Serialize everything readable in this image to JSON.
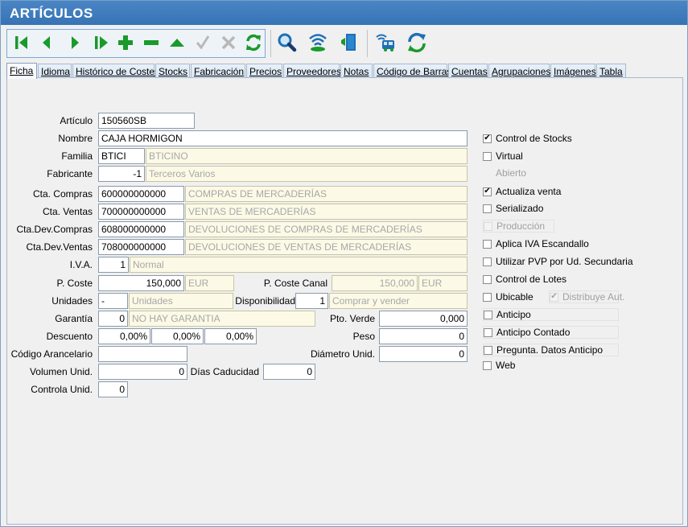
{
  "window": {
    "title": "ARTÍCULOS"
  },
  "toolbar": {
    "buttons": [
      {
        "name": "first-record",
        "icon": "first-icon"
      },
      {
        "name": "previous-record",
        "icon": "previous-icon"
      },
      {
        "name": "next-record",
        "icon": "next-icon"
      },
      {
        "name": "last-record",
        "icon": "last-icon"
      },
      {
        "name": "add-record",
        "icon": "plus-icon"
      },
      {
        "name": "delete-record",
        "icon": "minus-icon"
      },
      {
        "name": "edit-record",
        "icon": "triangle-up-icon"
      },
      {
        "name": "confirm-edit",
        "icon": "check-icon"
      },
      {
        "name": "cancel-edit",
        "icon": "x-icon"
      },
      {
        "name": "refresh",
        "icon": "refresh-icon"
      },
      {
        "name": "search",
        "icon": "magnifier-icon"
      },
      {
        "name": "broadcast",
        "icon": "signal-icon"
      },
      {
        "name": "exit",
        "icon": "door-icon"
      },
      {
        "name": "transport",
        "icon": "bus-icon"
      },
      {
        "name": "sync",
        "icon": "sync-icon"
      }
    ],
    "colors": {
      "accent": "#1a9a2a",
      "disabled": "#b0b0b0",
      "blue": "#1f6fb5"
    }
  },
  "tabs": [
    "Ficha",
    "Idioma",
    "Histórico de Costes",
    "Stocks",
    "Fabricación",
    "Precios",
    "Proveedores",
    "Notas",
    "Código de Barras",
    "Cuentas",
    "Agrupaciones",
    "Imágenes",
    "Tabla"
  ],
  "form": {
    "articulo": {
      "label": "Artículo",
      "value": "150560SB"
    },
    "nombre": {
      "label": "Nombre",
      "value": "CAJA HORMIGON"
    },
    "familia": {
      "label": "Familia",
      "code": "BTICI",
      "desc": "BTICINO"
    },
    "fabricante": {
      "label": "Fabricante",
      "code": "-1",
      "desc": "Terceros Varios"
    },
    "cta_compras": {
      "label": "Cta. Compras",
      "code": "600000000000",
      "desc": "COMPRAS DE MERCADERÍAS"
    },
    "cta_ventas": {
      "label": "Cta. Ventas",
      "code": "700000000000",
      "desc": "VENTAS DE MERCADERÍAS"
    },
    "cta_dev_compras": {
      "label": "Cta.Dev.Compras",
      "code": "608000000000",
      "desc": "DEVOLUCIONES DE COMPRAS DE MERCADERÍAS"
    },
    "cta_dev_ventas": {
      "label": "Cta.Dev.Ventas",
      "code": "708000000000",
      "desc": "DEVOLUCIONES DE VENTAS DE MERCADERÍAS"
    },
    "iva": {
      "label": "I.V.A.",
      "code": "1",
      "desc": "Normal"
    },
    "p_coste": {
      "label": "P. Coste",
      "value": "150,000",
      "currency": "EUR"
    },
    "p_coste_canal": {
      "label": "P. Coste Canal",
      "value": "150,000",
      "currency": "EUR"
    },
    "unidades": {
      "label": "Unidades",
      "code": "-",
      "desc": "Unidades"
    },
    "disponibilidad": {
      "label": "Disponibilidad",
      "code": "1",
      "desc": "Comprar y vender"
    },
    "garantia": {
      "label": "Garantía",
      "code": "0",
      "desc": "NO HAY GARANTIA"
    },
    "pto_verde": {
      "label": "Pto. Verde",
      "value": "0,000"
    },
    "descuento": {
      "label": "Descuento",
      "values": [
        "0,00%",
        "0,00%",
        "0,00%"
      ]
    },
    "peso": {
      "label": "Peso",
      "value": "0"
    },
    "codigo_arancelario": {
      "label": "Código Arancelario",
      "value": ""
    },
    "diametro": {
      "label": "Diámetro Unid.",
      "value": "0"
    },
    "volumen": {
      "label": "Volumen Unid.",
      "value": "0"
    },
    "dias_caducidad": {
      "label": "Días Caducidad",
      "value": "0"
    },
    "controla_unid": {
      "label": "Controla Unid.",
      "value": "0"
    }
  },
  "options": [
    {
      "label": "Control de Stocks",
      "checked": true,
      "disabled": false
    },
    {
      "label": "Virtual",
      "checked": false,
      "disabled": false
    },
    {
      "label": "Abierto",
      "checked": false,
      "disabled": true
    },
    {
      "label": "Actualiza venta",
      "checked": true,
      "disabled": false
    },
    {
      "label": "Serializado",
      "checked": false,
      "disabled": false
    },
    {
      "label": "Producción",
      "checked": false,
      "disabled": true
    },
    {
      "label": "Aplica IVA Escandallo",
      "checked": false,
      "disabled": false
    },
    {
      "label": "Utilizar PVP por Ud. Secundaria",
      "checked": false,
      "disabled": false
    },
    {
      "label": "Control de Lotes",
      "checked": false,
      "disabled": false
    },
    {
      "label": "Ubicable",
      "checked": false,
      "disabled": false
    },
    {
      "label": "Distribuye Aut.",
      "checked": true,
      "disabled": true
    },
    {
      "label": "Anticipo",
      "checked": false,
      "disabled": false
    },
    {
      "label": "Anticipo Contado",
      "checked": false,
      "disabled": false
    },
    {
      "label": "Pregunta. Datos Anticipo",
      "checked": false,
      "disabled": false
    },
    {
      "label": "Web",
      "checked": false,
      "disabled": false
    }
  ],
  "check_mark": "✔"
}
